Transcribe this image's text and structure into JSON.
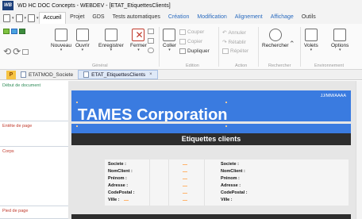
{
  "titlebar": {
    "logo": "WB",
    "title": "WD HC DOC Concepts - WEBDEV - [ETAT_EtiquettesClients]"
  },
  "ribbon_tabs": [
    "Accueil",
    "Projet",
    "GDS",
    "Tests automatiques",
    "Création",
    "Modification",
    "Alignement",
    "Affichage",
    "Outils"
  ],
  "ribbon": {
    "new_label": "Nouveau",
    "open_label": "Ouvrir",
    "save_label": "Enregistrer",
    "close_label": "Fermer",
    "paste_label": "Coller",
    "cut_label": "Couper",
    "copy_label": "Copier",
    "duplicate_label": "Dupliquer",
    "undo_label": "Annuler",
    "redo_label": "Rétablir",
    "repeat_label": "Répéter",
    "search_label": "Rechercher",
    "panes_label": "Volets",
    "options_label": "Options",
    "groups": [
      "Général",
      "Edition",
      "Action",
      "Rechercher",
      "Environnement"
    ]
  },
  "doc_tabs": {
    "pinned": "P",
    "tab1": "ETATMOD_Societe",
    "tab2": "ETAT_EtiquettesClients",
    "close_glyph": "×"
  },
  "blocks": {
    "doc_start": "Début de document",
    "page_header": "Entête de page",
    "body": "Corps",
    "page_footer": "Pied de page"
  },
  "report": {
    "company": "TAMES Corporation",
    "date_field": "JJ/MM/AAAA",
    "section_title": "Etiquettes clients",
    "labels": [
      "Societe :",
      "NomClient :",
      "Prénom :",
      "Adresse :",
      "CodePostal :",
      "Ville :"
    ]
  },
  "colors": {
    "banner": "#3a7be0",
    "dark_bar": "#2d2d2d",
    "block_label_red": "#c0392b",
    "block_label_green": "#2e8b57"
  }
}
